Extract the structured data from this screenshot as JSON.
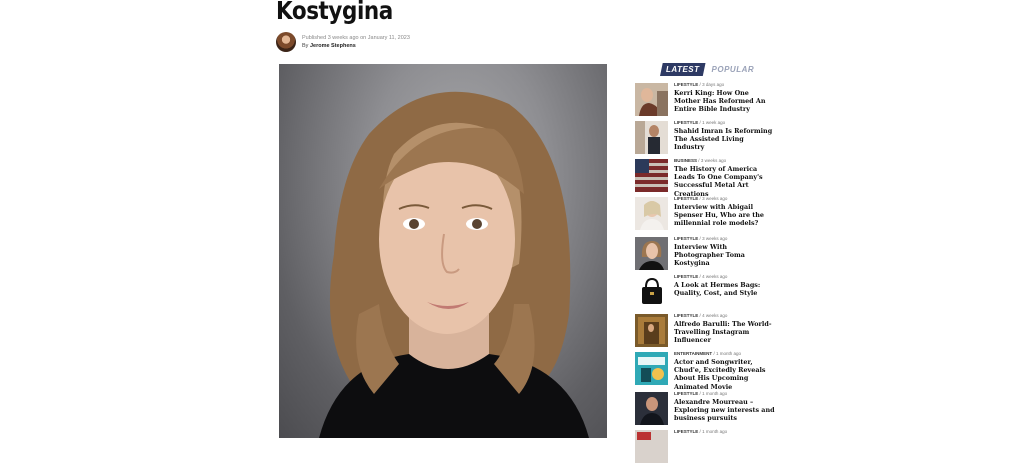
{
  "article": {
    "title": "Kostygina",
    "meta": {
      "published_prefix": "Published",
      "published_ago": "3 weeks ago",
      "on_word": "on",
      "date": "January 11, 2023",
      "by_word": "By",
      "author": "Jerome Stephens"
    }
  },
  "sidebar": {
    "tabs": [
      {
        "label": "LATEST",
        "active": true
      },
      {
        "label": "POPULAR",
        "active": false
      }
    ],
    "posts": [
      {
        "category": "LIFESTYLE",
        "time": "3 days ago",
        "title": "Kerri King: How One Mother Has Reformed An Entire Bible Industry"
      },
      {
        "category": "LIFESTYLE",
        "time": "1 week ago",
        "title": "Shahid Imran Is Reforming The Assisted Living Industry"
      },
      {
        "category": "BUSINESS",
        "time": "3 weeks ago",
        "title": "The History of America Leads To One Company's Successful Metal Art Creations"
      },
      {
        "category": "LIFESTYLE",
        "time": "3 weeks ago",
        "title": "Interview with Abigail Spenser Hu, Who are the millennial role models?"
      },
      {
        "category": "LIFESTYLE",
        "time": "3 weeks ago",
        "title": "Interview With Photographer Toma Kostygina"
      },
      {
        "category": "LIFESTYLE",
        "time": "4 weeks ago",
        "title": "A Look at Hermes Bags: Quality, Cost, and Style"
      },
      {
        "category": "LIFESTYLE",
        "time": "4 weeks ago",
        "title": "Alfredo Barulli: The World-Travelling Instagram Influencer"
      },
      {
        "category": "ENTERTAINMENT",
        "time": "1 month ago",
        "title": "Actor and Songwriter, Chud'e, Excitedly Reveals About His Upcoming Animated Movie"
      },
      {
        "category": "LIFESTYLE",
        "time": "1 month ago",
        "title": "Alexandre Mourreau – Exploring new interests and business pursuits"
      },
      {
        "category": "LIFESTYLE",
        "time": "1 month ago",
        "title": ""
      }
    ],
    "separator": "/"
  }
}
